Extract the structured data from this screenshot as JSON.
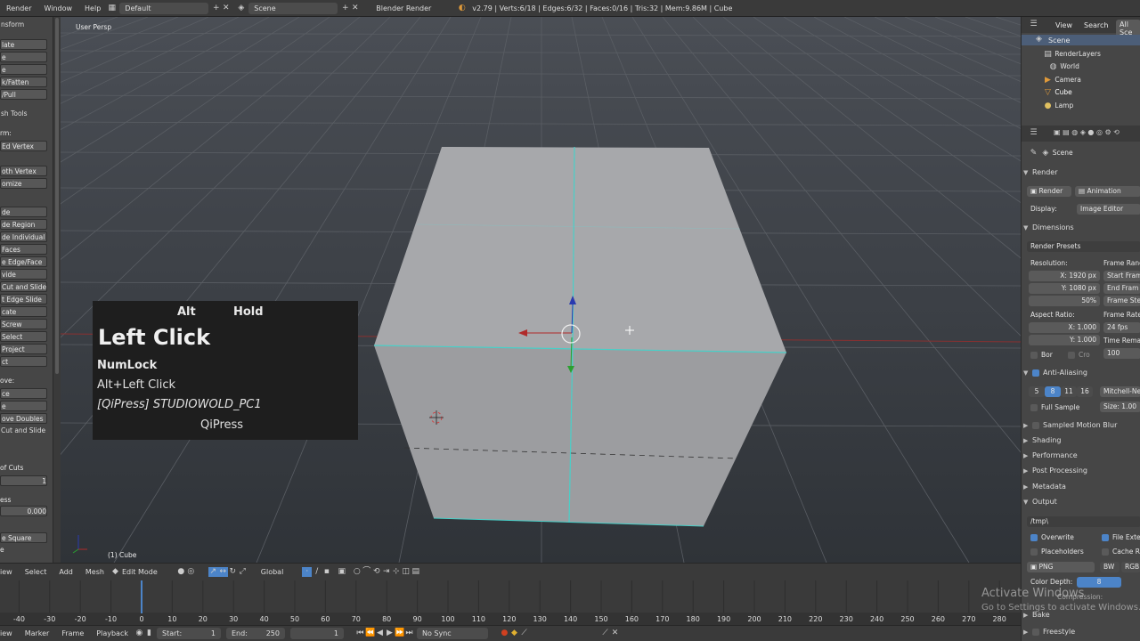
{
  "topbar": {
    "menus": [
      "Render",
      "Window",
      "Help"
    ],
    "layout": "Default",
    "scene": "Scene",
    "engine": "Blender Render",
    "stats": "v2.79 | Verts:6/18 | Edges:6/32 | Faces:0/16 | Tris:32 | Mem:9.86M | Cube"
  },
  "left": {
    "items": [
      {
        "t": "nsform",
        "k": "head"
      },
      {
        "t": "late",
        "k": "btn"
      },
      {
        "t": "e",
        "k": "btn"
      },
      {
        "t": "e",
        "k": "btn"
      },
      {
        "t": "k/Fatten",
        "k": "btn"
      },
      {
        "t": "/Pull",
        "k": "btn"
      },
      {
        "t": "sh Tools",
        "k": "head"
      },
      {
        "t": "rm:",
        "k": "text"
      },
      {
        "t": "Ed     Vertex",
        "k": "btn"
      },
      {
        "t": "oth Vertex",
        "k": "btn"
      },
      {
        "t": "omize",
        "k": "btn"
      },
      {
        "t": "de",
        "k": "btn"
      },
      {
        "t": "de Region",
        "k": "btn"
      },
      {
        "t": "de Individual",
        "k": "btn"
      },
      {
        "t": "Faces",
        "k": "btn"
      },
      {
        "t": "e Edge/Face",
        "k": "btn"
      },
      {
        "t": "vide",
        "k": "btn"
      },
      {
        "t": "Cut and Slide",
        "k": "btn"
      },
      {
        "t": "t Edge Slide",
        "k": "btn"
      },
      {
        "t": "cate",
        "k": "btn"
      },
      {
        "t": "Screw",
        "k": "btn"
      },
      {
        "t": "Select",
        "k": "btn"
      },
      {
        "t": "Project",
        "k": "btn"
      },
      {
        "t": "ct",
        "k": "btn"
      },
      {
        "t": "ove:",
        "k": "text"
      },
      {
        "t": "ce",
        "k": "btn"
      },
      {
        "t": "e",
        "k": "btn"
      },
      {
        "t": "ove Doubles",
        "k": "btn"
      },
      {
        "t": "Cut and Slide",
        "k": "head"
      },
      {
        "t": "of Cuts",
        "k": "text"
      },
      {
        "t": "1",
        "k": "btn"
      },
      {
        "t": "ess",
        "k": "text"
      },
      {
        "t": "0.000",
        "k": "btn"
      },
      {
        "t": "e Square",
        "k": "btn"
      },
      {
        "t": "e",
        "k": "text"
      }
    ]
  },
  "viewport": {
    "label": "User Persp",
    "object": "(1) Cube",
    "keys": {
      "alt": "Alt",
      "hold": "Hold",
      "main": "Left Click",
      "numlock": "NumLock",
      "combo": "Alt+Left Click",
      "qipress_line": "[QiPress] STUDIOWOLD_PC1",
      "qipress": "QiPress"
    }
  },
  "header3d": {
    "items": [
      "iew",
      "Select",
      "Add",
      "Mesh"
    ],
    "mode": "Edit Mode",
    "orientation": "Global"
  },
  "timeline": {
    "ticks": [
      "-40",
      "-30",
      "-20",
      "-10",
      "0",
      "10",
      "20",
      "30",
      "40",
      "50",
      "60",
      "70",
      "80",
      "90",
      "100",
      "110",
      "120",
      "130",
      "140",
      "150",
      "160",
      "170",
      "180",
      "190",
      "200",
      "210",
      "220",
      "230",
      "240",
      "250",
      "260",
      "270",
      "280"
    ],
    "current": 0
  },
  "tlbar": {
    "menus": [
      "iew",
      "Marker",
      "Frame",
      "Playback"
    ],
    "start_label": "Start:",
    "start": "1",
    "end_label": "End:",
    "end": "250",
    "current": "1",
    "sync": "No Sync"
  },
  "outliner": {
    "header": [
      "View",
      "Search",
      "All Sce"
    ],
    "items": [
      "Scene",
      "RenderLayers",
      "World",
      "Camera",
      "Cube",
      "Lamp"
    ]
  },
  "props": {
    "context": "Scene",
    "render_hdr": "Render",
    "render_btn": "Render",
    "anim_btn": "Animation",
    "display_label": "Display:",
    "display_val": "Image Editor",
    "dimensions": "Dimensions",
    "presets": "Render Presets",
    "resolution": "Resolution:",
    "res_x": "X:      1920 px",
    "res_y": "Y:      1080 px",
    "res_pct": "50%",
    "aspect": "Aspect Ratio:",
    "asp_x": "X:      1.000",
    "asp_y": "Y:      1.000",
    "bor": "Bor",
    "cro": "Cro",
    "frame_range": "Frame Rang",
    "start_frame": "Start Fram",
    "end_frame": "End Fram",
    "frame_step": "Frame Ste",
    "frame_rate": "Frame Rate",
    "fps": "24 fps",
    "time_remap": "Time Rema",
    "remap_val": "100",
    "aa": "Anti-Aliasing",
    "aa_samples": [
      "5",
      "8",
      "11",
      "16"
    ],
    "aa_filter": "Mitchell-Ne",
    "full_sample": "Full Sample",
    "size": "Size: 1.00",
    "panels": [
      "Sampled Motion Blur",
      "Shading",
      "Performance",
      "Post Processing",
      "Metadata"
    ],
    "output": "Output",
    "output_path": "/tmp\\",
    "overwrite": "Overwrite",
    "file_ext": "File Exte",
    "placeholders": "Placeholders",
    "cache": "Cache R",
    "png": "PNG",
    "bw": "BW",
    "rgb": "RGB",
    "color_depth": "Color Depth:",
    "depth_val": "8",
    "compression": "Compression:",
    "bake": "Bake",
    "freestyle": "Freestyle"
  },
  "watermark": {
    "title": "Activate Windows",
    "sub": "Go to Settings to activate Windows."
  }
}
